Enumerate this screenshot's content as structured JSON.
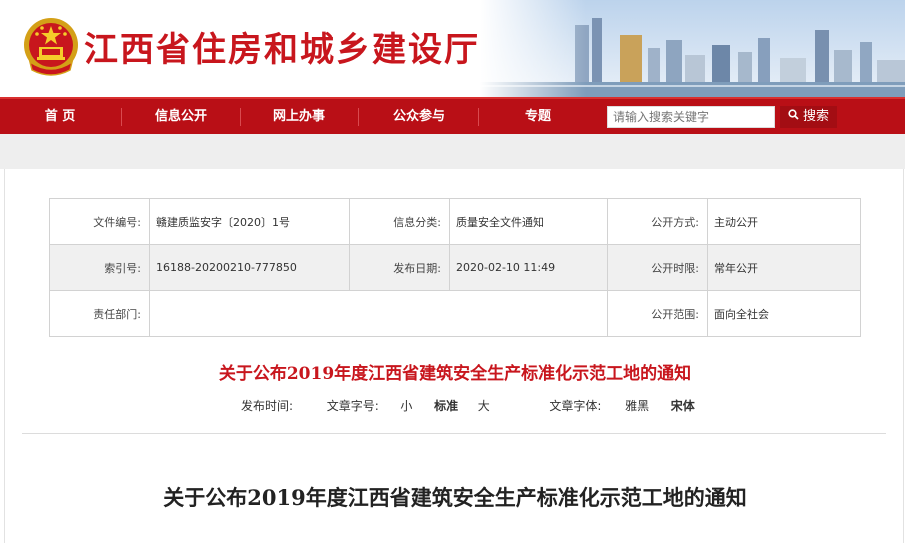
{
  "header": {
    "site_title": "江西省住房和城乡建设厅"
  },
  "nav": {
    "items": [
      "首 页",
      "信息公开",
      "网上办事",
      "公众参与",
      "专题"
    ],
    "search_placeholder": "请输入搜索关键字",
    "search_label": "搜索"
  },
  "info": {
    "file_no_label": "文件编号:",
    "file_no": "赣建质监安字〔2020〕1号",
    "category_label": "信息分类:",
    "category": "质量安全文件通知",
    "open_mode_label": "公开方式:",
    "open_mode": "主动公开",
    "index_label": "索引号:",
    "index": "16188-20200210-777850",
    "date_label": "发布日期:",
    "date": "2020-02-10 11:49",
    "open_time_label": "公开时限:",
    "open_time": "常年公开",
    "dept_label": "责任部门:",
    "dept": "",
    "scope_label": "公开范围:",
    "scope": "面向全社会"
  },
  "article": {
    "title_red": "关于公布2019年度江西省建筑安全生产标准化示范工地的通知",
    "publish_time_label": "发布时间:",
    "font_size_label": "文章字号:",
    "size_small": "小",
    "size_standard": "标准",
    "size_large": "大",
    "font_face_label": "文章字体:",
    "font_yahei": "雅黑",
    "font_song": "宋体",
    "title_black": "关于公布2019年度江西省建筑安全生产标准化示范工地的通知"
  },
  "colors": {
    "brand_red": "#c8161d",
    "nav_red": "#b90f16"
  }
}
